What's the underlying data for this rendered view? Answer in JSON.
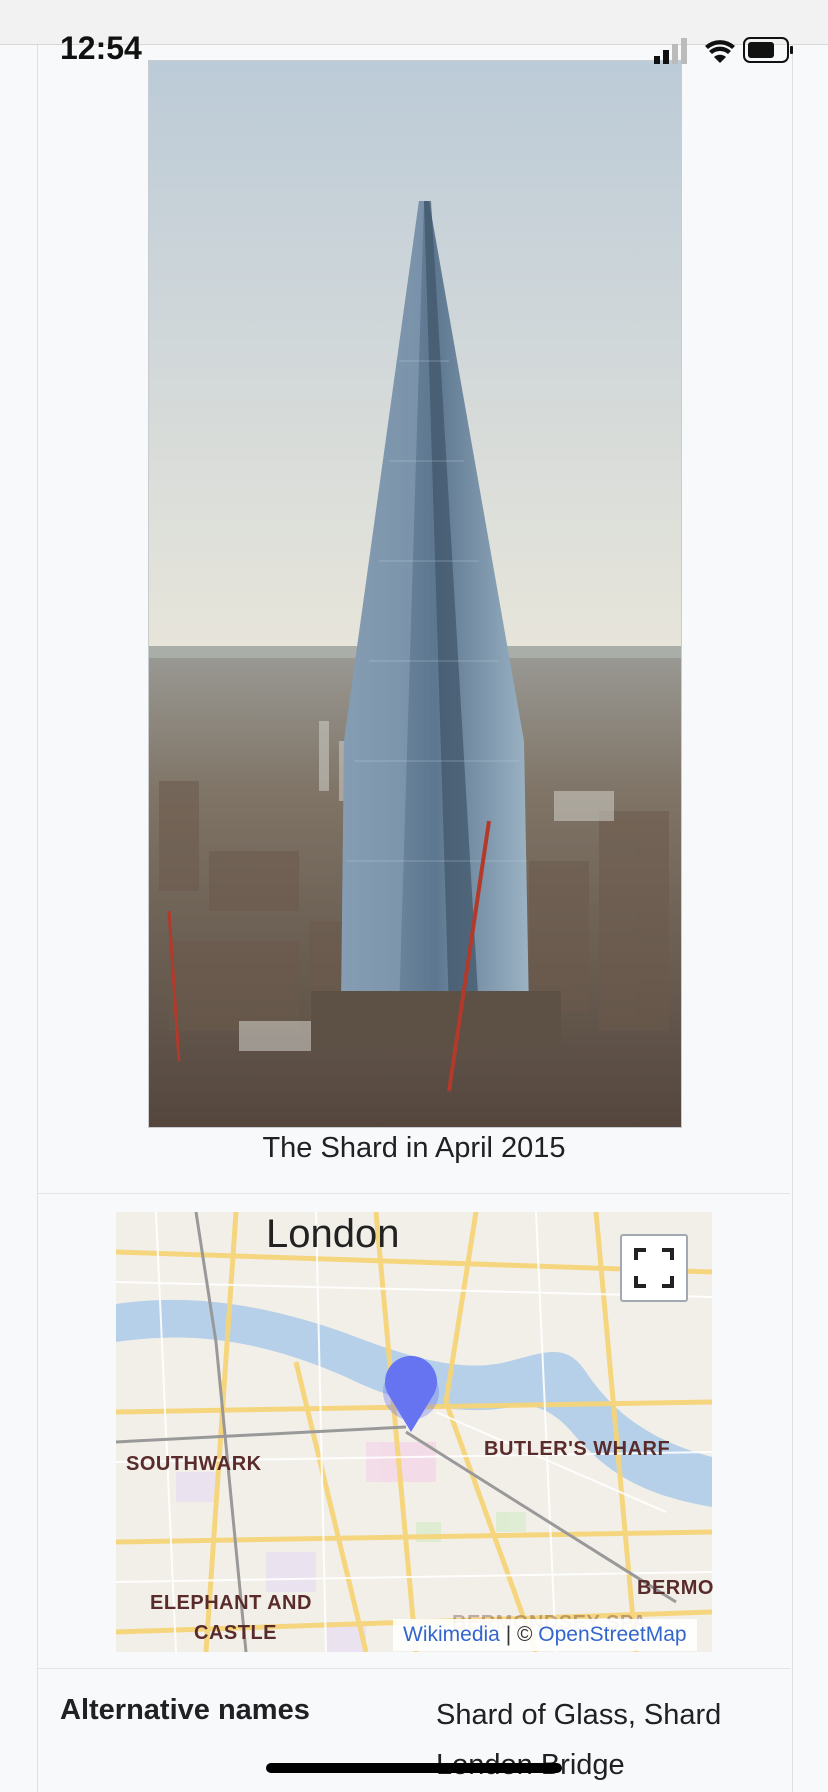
{
  "status": {
    "time": "12:54"
  },
  "infobox": {
    "image_caption": "The Shard in April 2015",
    "map": {
      "city_label": "London",
      "districts": [
        "SOUTHWARK",
        "BUTLER'S WHARF",
        "ELEPHANT AND",
        "CASTLE",
        "BERMO",
        "BERMONDSEY SPA"
      ],
      "attribution_wikimedia": "Wikimedia",
      "attribution_separator": " | © ",
      "attribution_osm": "OpenStreetMap"
    },
    "alt_names": {
      "label": "Alternative names",
      "value": "Shard of Glass, Shard London Bridge"
    }
  },
  "colors": {
    "link": "#3366cc",
    "marker": "#6674f2",
    "river": "#b5d0e8",
    "road": "#f6d57a"
  }
}
